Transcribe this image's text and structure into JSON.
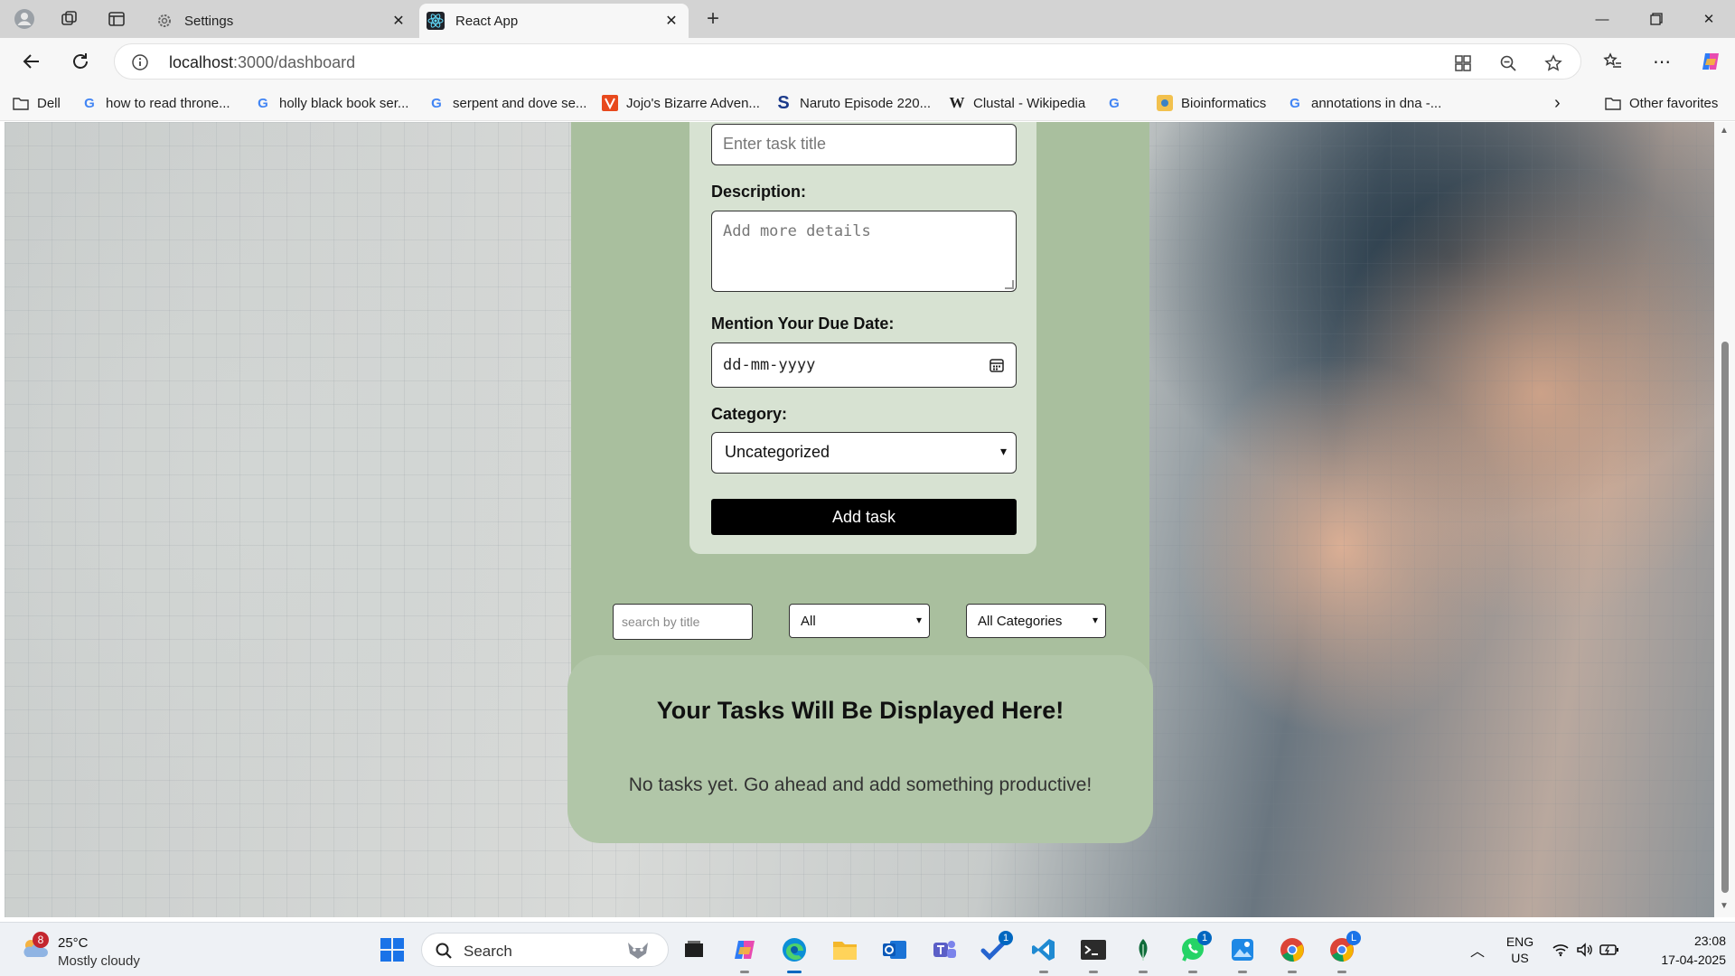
{
  "browser": {
    "tabs": [
      {
        "label": "Settings",
        "icon": "gear-icon",
        "active": false
      },
      {
        "label": "React App",
        "icon": "react-icon",
        "active": true
      }
    ],
    "url_host": "localhost",
    "url_path": ":3000/dashboard",
    "bookmarks": [
      {
        "label": "Dell",
        "icon": "folder-icon"
      },
      {
        "label": "how to read throne...",
        "icon": "google-icon"
      },
      {
        "label": "holly black book ser...",
        "icon": "google-icon"
      },
      {
        "label": "serpent and dove se...",
        "icon": "google-icon"
      },
      {
        "label": "Jojo's Bizarre Adven...",
        "icon": "jojo-icon"
      },
      {
        "label": "Naruto Episode 220...",
        "icon": "s-icon"
      },
      {
        "label": "Clustal - Wikipedia",
        "icon": "wikipedia-icon"
      },
      {
        "label": "",
        "icon": "google-icon"
      },
      {
        "label": "Bioinformatics",
        "icon": "bioinformatics-icon"
      },
      {
        "label": "annotations in dna -...",
        "icon": "google-icon"
      }
    ],
    "other_favorites": "Other favorites"
  },
  "form": {
    "title_placeholder": "Enter task title",
    "description_label": "Description:",
    "description_placeholder": "Add more details",
    "due_date_label": "Mention Your Due Date:",
    "due_date_placeholder": "dd-mm-yyyy",
    "category_label": "Category:",
    "category_value": "Uncategorized",
    "add_button": "Add task"
  },
  "filters": {
    "search_placeholder": "search by title",
    "status_value": "All",
    "category_value": "All Categories"
  },
  "tasks": {
    "heading": "Your Tasks Will Be Displayed Here!",
    "empty_message": "No tasks yet. Go ahead and add something productive!"
  },
  "taskbar": {
    "weather_badge": "8",
    "temperature": "25°C",
    "condition": "Mostly cloudy",
    "search_label": "Search",
    "todo_badge": "1",
    "whatsapp_badge": "1",
    "chrome_profile": "L",
    "language": "ENG",
    "region": "US",
    "time": "23:08",
    "date": "17-04-2025"
  },
  "colors": {
    "form_outer": "#a9bf9e",
    "form_card": "#d7e2d2",
    "tasks_card": "#b1c6a8",
    "button": "#000000",
    "accent": "#0067c0"
  }
}
